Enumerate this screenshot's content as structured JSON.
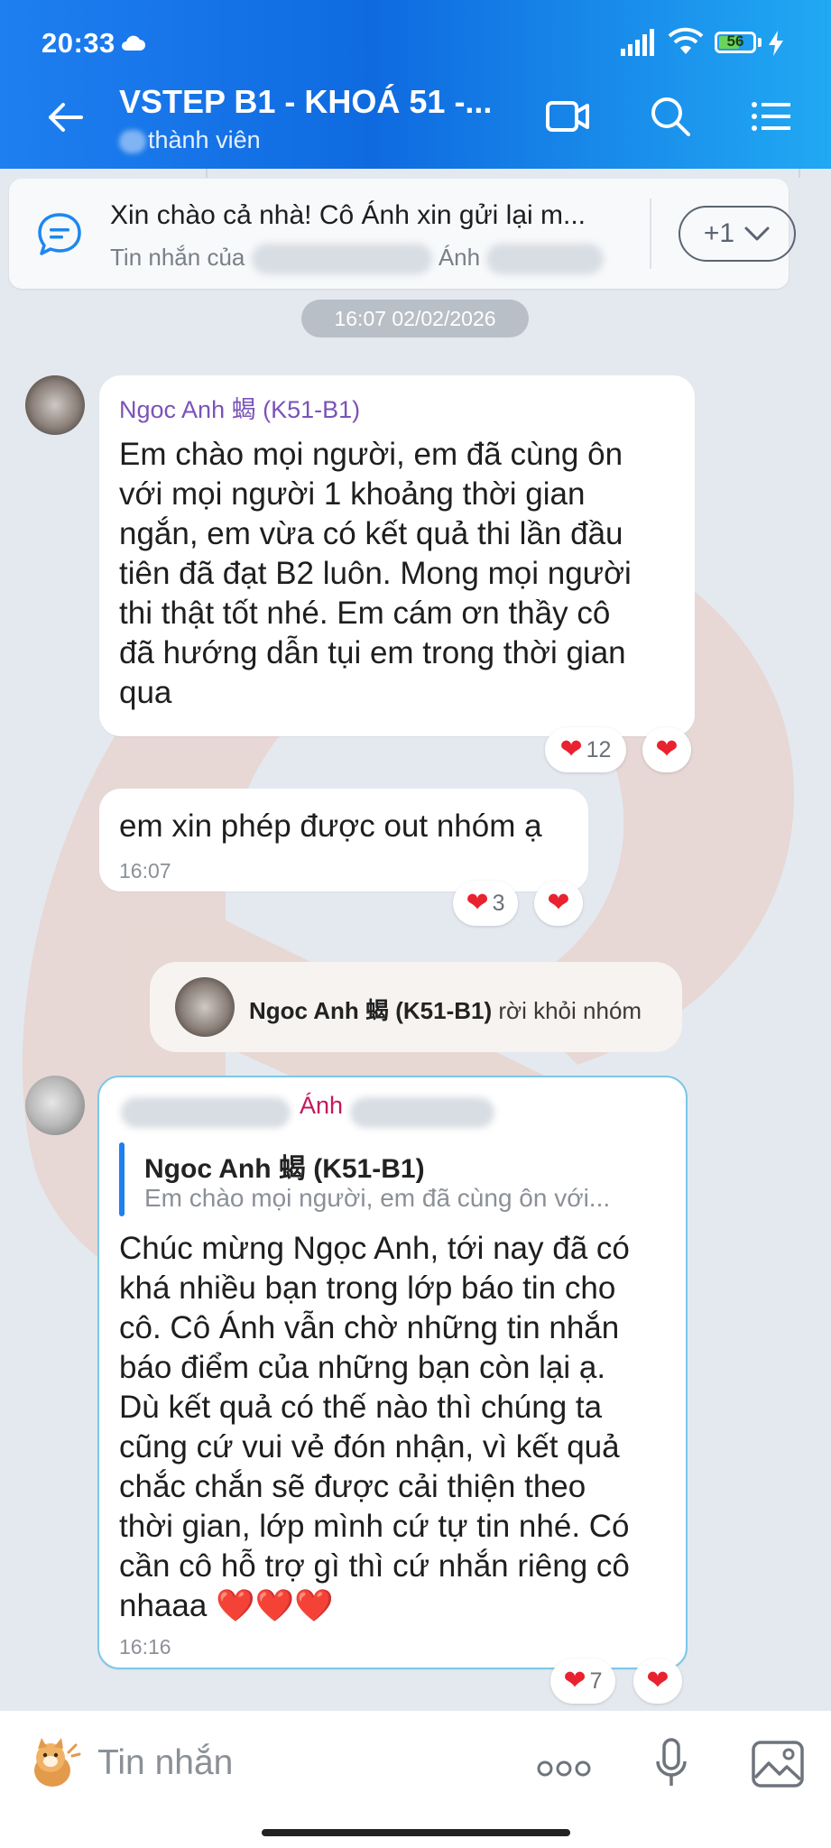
{
  "status": {
    "time": "20:33",
    "battery": "56"
  },
  "header": {
    "title": "VSTEP B1 - KHOÁ 51 -...",
    "subtitle": "thành viên"
  },
  "pinned": {
    "text": "Xin chào cả nhà! Cô Ánh xin gửi lại m...",
    "sub_prefix": "Tin nhắn của",
    "sub_name": "Ánh",
    "more_label": "+1"
  },
  "date_chip": "16:07 02/02/2026",
  "messages": [
    {
      "sender": "Ngoc Anh 蝎 (K51-B1)",
      "lines": [
        "Em chào mọi người, em đã cùng ôn",
        "với mọi người 1 khoảng thời gian",
        "ngắn, em vừa có kết quả thi lần đầu",
        "tiên đã đạt B2 luôn. Mong mọi người",
        "thi thật tốt nhé. Em cám ơn thầy cô",
        "đã hướng dẫn tụi em trong thời gian",
        "qua"
      ],
      "reaction_count": "12"
    },
    {
      "text": "em xin phép được out nhóm ạ",
      "time": "16:07",
      "reaction_count": "3"
    }
  ],
  "system": {
    "name": "Ngoc Anh 蝎 (K51-B1)",
    "action": "rời khỏi nhóm"
  },
  "reply": {
    "sender": "Ánh",
    "quote_name": "Ngoc Anh 蝎 (K51-B1)",
    "quote_text": "Em chào mọi người, em đã cùng ôn với...",
    "lines": [
      "Chúc mừng Ngọc Anh, tới nay đã có",
      "khá nhiều bạn trong lớp báo tin cho",
      "cô. Cô Ánh vẫn chờ những tin nhắn",
      "báo điểm của những bạn còn lại ạ.",
      "Dù kết quả có thế nào thì chúng ta",
      "cũng cứ vui vẻ đón nhận, vì kết quả",
      "chắc chắn sẽ được cải thiện theo",
      "thời gian, lớp mình cứ tự tin nhé. Có",
      "cần cô hỗ trợ gì thì cứ nhắn riêng cô",
      "nhaaa ❤️❤️❤️"
    ],
    "time": "16:16",
    "reaction_count": "7"
  },
  "composer": {
    "placeholder": "Tin nhắn"
  },
  "colors": {
    "header_start": "#1e7ff0",
    "header_end": "#21a9f3",
    "heart": "#e8222e",
    "sender": "#7a53b8",
    "reply_sender": "#c2185b"
  },
  "icons": [
    "cloud-icon",
    "signal-icon",
    "wifi-icon",
    "battery-icon",
    "back-arrow-icon",
    "video-call-icon",
    "search-icon",
    "menu-icon",
    "pinned-chat-icon",
    "chevron-down-icon",
    "heart-icon",
    "more-dots-icon",
    "microphone-icon",
    "image-icon",
    "sticker-icon"
  ]
}
